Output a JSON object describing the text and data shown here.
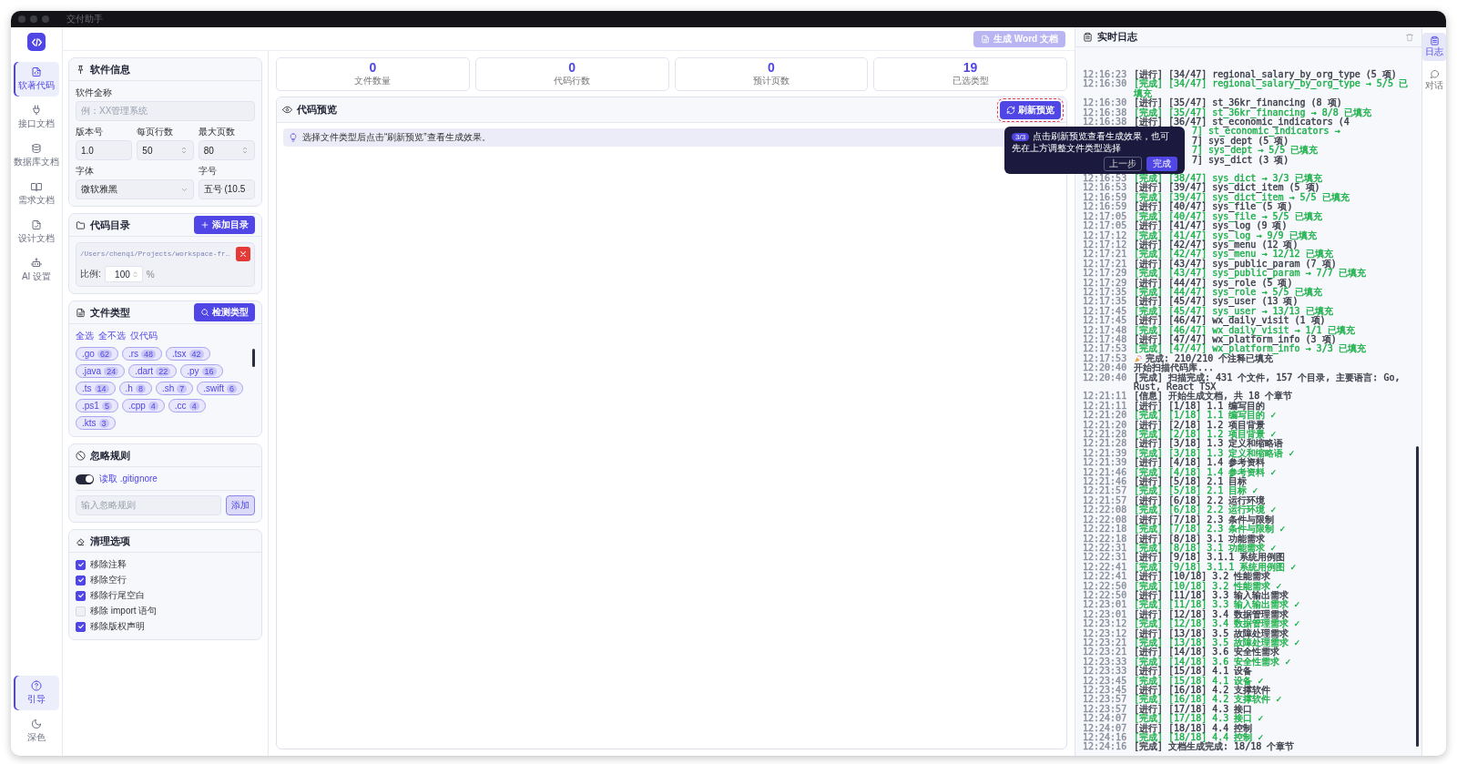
{
  "window": {
    "title": "交付助手"
  },
  "nav": {
    "items": [
      {
        "label": "软著代码",
        "selected": true
      },
      {
        "label": "接口文档",
        "selected": false
      },
      {
        "label": "数据库文档",
        "selected": false
      },
      {
        "label": "需求文档",
        "selected": false
      },
      {
        "label": "设计文档",
        "selected": false
      },
      {
        "label": "AI 设置",
        "selected": false
      }
    ],
    "bottom": [
      {
        "label": "引导",
        "selected": true
      },
      {
        "label": "深色",
        "selected": false
      }
    ]
  },
  "toolbar": {
    "generate_button": "生成 Word 文档",
    "disabled": true
  },
  "software_info": {
    "title": "软件信息",
    "fields": [
      {
        "label": "软件全称",
        "kind": "text",
        "placeholder": "例：XX管理系统"
      },
      {
        "label": "版本号",
        "kind": "text",
        "value": "1.0"
      },
      {
        "label": "每页行数",
        "kind": "number",
        "value": "50"
      },
      {
        "label": "最大页数",
        "kind": "number",
        "value": "80"
      },
      {
        "label": "字体",
        "kind": "select",
        "value": "微软雅黑"
      },
      {
        "label": "字号",
        "kind": "select",
        "value": "五号 (10.5"
      }
    ]
  },
  "code_dir": {
    "title": "代码目录",
    "add_button": "添加目录",
    "path": "/Users/chenqi/Projects/workspace-fr…",
    "ratio_label": "比例:",
    "ratio": "100",
    "unit": "%"
  },
  "file_types": {
    "title": "文件类型",
    "detect_button": "检测类型",
    "links": [
      "全选",
      "全不选",
      "仅代码"
    ],
    "types": [
      {
        "ext": ".go",
        "count": "62"
      },
      {
        "ext": ".rs",
        "count": "48"
      },
      {
        "ext": ".tsx",
        "count": "42"
      },
      {
        "ext": ".java",
        "count": "24"
      },
      {
        "ext": ".dart",
        "count": "22"
      },
      {
        "ext": ".py",
        "count": "16"
      },
      {
        "ext": ".ts",
        "count": "14"
      },
      {
        "ext": ".h",
        "count": "8"
      },
      {
        "ext": ".sh",
        "count": "7"
      },
      {
        "ext": ".swift",
        "count": "6"
      },
      {
        "ext": ".ps1",
        "count": "5"
      },
      {
        "ext": ".cpp",
        "count": "4"
      },
      {
        "ext": ".cc",
        "count": "4"
      },
      {
        "ext": ".kts",
        "count": "3"
      }
    ]
  },
  "ignore_rules": {
    "title": "忽略规则",
    "gitignore": {
      "label": "读取 .gitignore",
      "on": true
    },
    "placeholder": "输入忽略规则",
    "add_button": "添加"
  },
  "clean_options": {
    "title": "清理选项",
    "options": [
      {
        "label": "移除注释",
        "checked": true
      },
      {
        "label": "移除空行",
        "checked": true
      },
      {
        "label": "移除行尾空白",
        "checked": true
      },
      {
        "label": "移除 import 语句",
        "checked": false
      },
      {
        "label": "移除版权声明",
        "checked": true
      }
    ]
  },
  "stats": [
    {
      "value": "0",
      "label": "文件数量"
    },
    {
      "value": "0",
      "label": "代码行数"
    },
    {
      "value": "0",
      "label": "预计页数"
    },
    {
      "value": "19",
      "label": "已选类型"
    }
  ],
  "preview": {
    "title": "代码预览",
    "refresh_button": "刷新预览",
    "hint": "选择文件类型后点击“刷新预览”查看生成效果。"
  },
  "tour": {
    "step": "3/3",
    "text": "点击刷新预览查看生成效果，也可先在上方调整文件类型选择",
    "prev_button": "上一步",
    "done_button": "完成"
  },
  "log": {
    "title": "实时日志",
    "entries": [
      {
        "kind": "line",
        "color": "#3a3d48",
        "time": "12:16:23",
        "text": "[进行] [34/47] regional_salary_by_org_type (5 项)"
      },
      {
        "kind": "line",
        "color": "#1db14b",
        "time": "12:16:30",
        "text": "[完成] [34/47] regional_salary_by_org_type → 5/5 已填充"
      },
      {
        "kind": "line",
        "color": "#3a3d48",
        "time": "12:16:30",
        "text": "[进行] [35/47] st_36kr_financing (8 项)"
      },
      {
        "kind": "line",
        "color": "#1db14b",
        "time": "12:16:38",
        "text": "[完成] [35/47] st_36kr_financing → 8/8 已填充"
      },
      {
        "kind": "line",
        "color": "#3a3d48",
        "time": "12:16:38",
        "text": "[进行] [36/47] st_economic_indicators (4"
      },
      {
        "kind": "covered",
        "color": "#1db14b",
        "text": "7] st_economic_indicators →"
      },
      {
        "kind": "covered",
        "color": "#3a3d48",
        "text": "7] sys_dept (5 项)"
      },
      {
        "kind": "covered",
        "color": "#1db14b",
        "text": "7] sys_dept → 5/5 已填充"
      },
      {
        "kind": "covered",
        "color": "#3a3d48",
        "text": "7] sys_dict (3 项)"
      },
      {
        "kind": "line",
        "color": "#1db14b",
        "time": "12:16:53",
        "text": "[完成] [38/47] sys_dict → 3/3 已填充"
      },
      {
        "kind": "line",
        "color": "#3a3d48",
        "time": "12:16:53",
        "text": "[进行] [39/47] sys_dict_item (5 项)"
      },
      {
        "kind": "line",
        "color": "#1db14b",
        "time": "12:16:59",
        "text": "[完成] [39/47] sys_dict_item → 5/5 已填充"
      },
      {
        "kind": "line",
        "color": "#3a3d48",
        "time": "12:16:59",
        "text": "[进行] [40/47] sys_file (5 项)"
      },
      {
        "kind": "line",
        "color": "#1db14b",
        "time": "12:17:05",
        "text": "[完成] [40/47] sys_file → 5/5 已填充"
      },
      {
        "kind": "line",
        "color": "#3a3d48",
        "time": "12:17:05",
        "text": "[进行] [41/47] sys_log (9 项)"
      },
      {
        "kind": "line",
        "color": "#1db14b",
        "time": "12:17:12",
        "text": "[完成] [41/47] sys_log → 9/9 已填充"
      },
      {
        "kind": "line",
        "color": "#3a3d48",
        "time": "12:17:12",
        "text": "[进行] [42/47] sys_menu (12 项)"
      },
      {
        "kind": "line",
        "color": "#1db14b",
        "time": "12:17:21",
        "text": "[完成] [42/47] sys_menu → 12/12 已填充"
      },
      {
        "kind": "line",
        "color": "#3a3d48",
        "time": "12:17:21",
        "text": "[进行] [43/47] sys_public_param (7 项)"
      },
      {
        "kind": "line",
        "color": "#1db14b",
        "time": "12:17:29",
        "text": "[完成] [43/47] sys_public_param → 7/7 已填充"
      },
      {
        "kind": "line",
        "color": "#3a3d48",
        "time": "12:17:29",
        "text": "[进行] [44/47] sys_role (5 项)"
      },
      {
        "kind": "line",
        "color": "#1db14b",
        "time": "12:17:35",
        "text": "[完成] [44/47] sys_role → 5/5 已填充"
      },
      {
        "kind": "line",
        "color": "#3a3d48",
        "time": "12:17:35",
        "text": "[进行] [45/47] sys_user (13 项)"
      },
      {
        "kind": "line",
        "color": "#1db14b",
        "time": "12:17:45",
        "text": "[完成] [45/47] sys_user → 13/13 已填充"
      },
      {
        "kind": "line",
        "color": "#3a3d48",
        "time": "12:17:45",
        "text": "[进行] [46/47] wx_daily_visit (1 项)"
      },
      {
        "kind": "line",
        "color": "#1db14b",
        "time": "12:17:48",
        "text": "[完成] [46/47] wx_daily_visit → 1/1 已填充"
      },
      {
        "kind": "line",
        "color": "#3a3d48",
        "time": "12:17:48",
        "text": "[进行] [47/47] wx_platform_info (3 项)"
      },
      {
        "kind": "line",
        "color": "#1db14b",
        "time": "12:17:53",
        "text": "[完成] [47/47] wx_platform_info → 3/3 已填充"
      },
      {
        "kind": "celebrate",
        "color": "#3a3d48",
        "time": "12:17:53",
        "text": "完成: 210/210 个注释已填充"
      },
      {
        "kind": "line",
        "color": "#3a3d48",
        "time": "12:20:40",
        "text": "开始扫描代码库..."
      },
      {
        "kind": "line",
        "color": "#3a3d48",
        "time": "12:20:40",
        "text": "[完成] 扫描完成: 431 个文件, 157 个目录, 主要语言: Go, Rust, React TSX"
      },
      {
        "kind": "line",
        "color": "#3a3d48",
        "time": "12:21:11",
        "text": "[信息] 开始生成文档, 共 18 个章节"
      },
      {
        "kind": "line",
        "color": "#3a3d48",
        "time": "12:21:11",
        "text": "[进行] [1/18] 1.1 编写目的"
      },
      {
        "kind": "line",
        "color": "#1db14b",
        "time": "12:21:20",
        "text": "[完成] [1/18] 1.1 编写目的 ✓"
      },
      {
        "kind": "line",
        "color": "#3a3d48",
        "time": "12:21:20",
        "text": "[进行] [2/18] 1.2 项目背景"
      },
      {
        "kind": "line",
        "color": "#1db14b",
        "time": "12:21:28",
        "text": "[完成] [2/18] 1.2 项目背景 ✓"
      },
      {
        "kind": "line",
        "color": "#3a3d48",
        "time": "12:21:28",
        "text": "[进行] [3/18] 1.3 定义和缩略语"
      },
      {
        "kind": "line",
        "color": "#1db14b",
        "time": "12:21:39",
        "text": "[完成] [3/18] 1.3 定义和缩略语 ✓"
      },
      {
        "kind": "line",
        "color": "#3a3d48",
        "time": "12:21:39",
        "text": "[进行] [4/18] 1.4 参考资料"
      },
      {
        "kind": "line",
        "color": "#1db14b",
        "time": "12:21:46",
        "text": "[完成] [4/18] 1.4 参考资料 ✓"
      },
      {
        "kind": "line",
        "color": "#3a3d48",
        "time": "12:21:46",
        "text": "[进行] [5/18] 2.1 目标"
      },
      {
        "kind": "line",
        "color": "#1db14b",
        "time": "12:21:57",
        "text": "[完成] [5/18] 2.1 目标 ✓"
      },
      {
        "kind": "line",
        "color": "#3a3d48",
        "time": "12:21:57",
        "text": "[进行] [6/18] 2.2 运行环境"
      },
      {
        "kind": "line",
        "color": "#1db14b",
        "time": "12:22:08",
        "text": "[完成] [6/18] 2.2 运行环境 ✓"
      },
      {
        "kind": "line",
        "color": "#3a3d48",
        "time": "12:22:08",
        "text": "[进行] [7/18] 2.3 条件与限制"
      },
      {
        "kind": "line",
        "color": "#1db14b",
        "time": "12:22:18",
        "text": "[完成] [7/18] 2.3 条件与限制 ✓"
      },
      {
        "kind": "line",
        "color": "#3a3d48",
        "time": "12:22:18",
        "text": "[进行] [8/18] 3.1 功能需求"
      },
      {
        "kind": "line",
        "color": "#1db14b",
        "time": "12:22:31",
        "text": "[完成] [8/18] 3.1 功能需求 ✓"
      },
      {
        "kind": "line",
        "color": "#3a3d48",
        "time": "12:22:31",
        "text": "[进行] [9/18] 3.1.1 系统用例图"
      },
      {
        "kind": "line",
        "color": "#1db14b",
        "time": "12:22:41",
        "text": "[完成] [9/18] 3.1.1 系统用例图 ✓"
      },
      {
        "kind": "line",
        "color": "#3a3d48",
        "time": "12:22:41",
        "text": "[进行] [10/18] 3.2 性能需求"
      },
      {
        "kind": "line",
        "color": "#1db14b",
        "time": "12:22:50",
        "text": "[完成] [10/18] 3.2 性能需求 ✓"
      },
      {
        "kind": "line",
        "color": "#3a3d48",
        "time": "12:22:50",
        "text": "[进行] [11/18] 3.3 输入输出需求"
      },
      {
        "kind": "line",
        "color": "#1db14b",
        "time": "12:23:01",
        "text": "[完成] [11/18] 3.3 输入输出需求 ✓"
      },
      {
        "kind": "line",
        "color": "#3a3d48",
        "time": "12:23:01",
        "text": "[进行] [12/18] 3.4 数据管理需求"
      },
      {
        "kind": "line",
        "color": "#1db14b",
        "time": "12:23:12",
        "text": "[完成] [12/18] 3.4 数据管理需求 ✓"
      },
      {
        "kind": "line",
        "color": "#3a3d48",
        "time": "12:23:12",
        "text": "[进行] [13/18] 3.5 故障处理需求"
      },
      {
        "kind": "line",
        "color": "#1db14b",
        "time": "12:23:21",
        "text": "[完成] [13/18] 3.5 故障处理需求 ✓"
      },
      {
        "kind": "line",
        "color": "#3a3d48",
        "time": "12:23:21",
        "text": "[进行] [14/18] 3.6 安全性需求"
      },
      {
        "kind": "line",
        "color": "#1db14b",
        "time": "12:23:33",
        "text": "[完成] [14/18] 3.6 安全性需求 ✓"
      },
      {
        "kind": "line",
        "color": "#3a3d48",
        "time": "12:23:33",
        "text": "[进行] [15/18] 4.1 设备"
      },
      {
        "kind": "line",
        "color": "#1db14b",
        "time": "12:23:45",
        "text": "[完成] [15/18] 4.1 设备 ✓"
      },
      {
        "kind": "line",
        "color": "#3a3d48",
        "time": "12:23:45",
        "text": "[进行] [16/18] 4.2 支撑软件"
      },
      {
        "kind": "line",
        "color": "#1db14b",
        "time": "12:23:57",
        "text": "[完成] [16/18] 4.2 支撑软件 ✓"
      },
      {
        "kind": "line",
        "color": "#3a3d48",
        "time": "12:23:57",
        "text": "[进行] [17/18] 4.3 接口"
      },
      {
        "kind": "line",
        "color": "#1db14b",
        "time": "12:24:07",
        "text": "[完成] [17/18] 4.3 接口 ✓"
      },
      {
        "kind": "line",
        "color": "#3a3d48",
        "time": "12:24:07",
        "text": "[进行] [18/18] 4.4 控制"
      },
      {
        "kind": "line",
        "color": "#1db14b",
        "time": "12:24:16",
        "text": "[完成] [18/18] 4.4 控制 ✓"
      },
      {
        "kind": "line",
        "color": "#3a3d48",
        "time": "12:24:16",
        "text": "[完成] 文档生成完成: 18/18 个章节"
      }
    ]
  },
  "right_rail": [
    {
      "label": "日志",
      "selected": true
    },
    {
      "label": "对话",
      "selected": false
    }
  ]
}
